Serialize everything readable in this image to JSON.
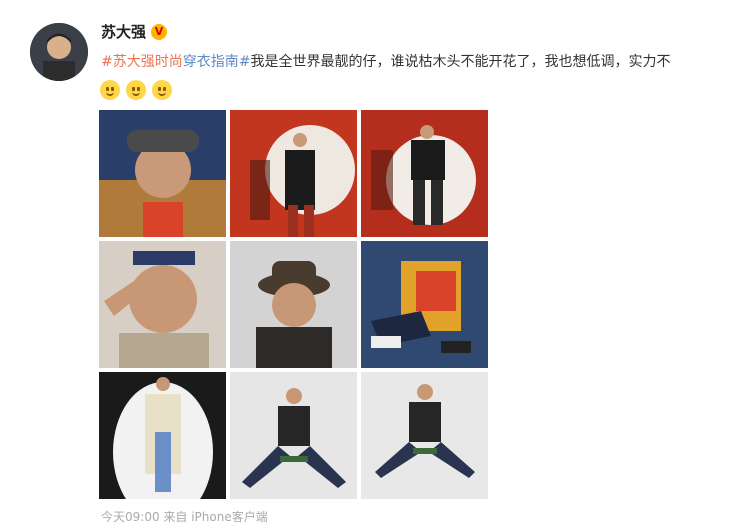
{
  "post": {
    "username": "苏大强",
    "badge_label": "V",
    "text_tag_1": "#苏大强时尚",
    "text_tag_2": "穿衣指南#",
    "text_body": "我是全世界最靓的仔，谁说枯木头不能开花了，我也想低调，实力不",
    "footer": "今天09:00 来自 iPhone客户端"
  },
  "emojis": [
    "smile-emoji",
    "smile-emoji",
    "smile-emoji"
  ],
  "photos": [
    {
      "bg": "#2a3e6a",
      "accent": "#d8432a",
      "caption": ""
    },
    {
      "bg": "#c2361f",
      "accent": "#1b1b1b",
      "caption": ""
    },
    {
      "bg": "#b52d1c",
      "accent": "#1b1b1b",
      "caption": ""
    },
    {
      "bg": "#d7cfc5",
      "accent": "#4a3b2f",
      "caption": ""
    },
    {
      "bg": "#d3d3d3",
      "accent": "#2e2a28",
      "caption": ""
    },
    {
      "bg": "#2f4970",
      "accent": "#e1a22a",
      "caption": ""
    },
    {
      "bg": "#f2f2f2",
      "accent": "#222222",
      "caption": ""
    },
    {
      "bg": "#e6e6e6",
      "accent": "#262626",
      "caption": ""
    },
    {
      "bg": "#e8e8e8",
      "accent": "#262626",
      "caption": ""
    }
  ],
  "colors": {
    "tag": "#eb7350",
    "tag2": "#5d8ac9",
    "badge": "#ffb400"
  }
}
